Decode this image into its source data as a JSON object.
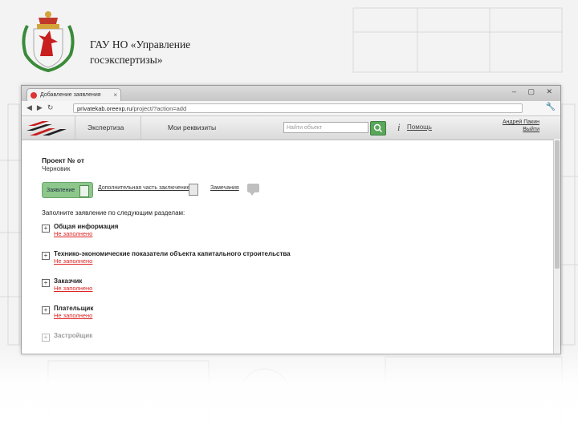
{
  "organization": {
    "title_line1": "ГАУ НО «Управление",
    "title_line2": "госэкспертизы»"
  },
  "browser": {
    "tab_title": "Добавление заявления",
    "url_prefix": "privatekab.oreexp.ru",
    "url_path": "/project/?action=add",
    "window_controls": "– ▢ ✕"
  },
  "app_header": {
    "nav_expertise": "Экспертиза",
    "nav_requisites": "Мои реквизиты",
    "search_placeholder": "Найти объект",
    "help_icon": "i",
    "help_label": "Помощь",
    "user_name": "Андрей Пакин",
    "logout_label": "Выйти"
  },
  "project": {
    "title": "Проект № от",
    "status": "Черновик"
  },
  "tabs": {
    "application": "Заявление",
    "additional": "Дополнительная часть заключение",
    "remarks": "Замечания"
  },
  "instructions": "Заполните заявление по следующим разделам:",
  "sections": [
    {
      "title": "Общая информация",
      "status": "Не заполнено"
    },
    {
      "title": "Технико-экономические показатели объекта капитального строительства",
      "status": "Не заполнено"
    },
    {
      "title": "Заказчик",
      "status": "Не заполнено"
    },
    {
      "title": "Плательщик",
      "status": "Не заполнено"
    },
    {
      "title": "Застройщик",
      "status": ""
    }
  ],
  "colors": {
    "accent_green": "#8dc78c",
    "status_red": "#d22222",
    "brand_red": "#c81e1e"
  },
  "icons": {
    "crest": "nizhny-novgorod-coat-of-arms",
    "logo": "red-black-stripes-logo",
    "search": "search-icon",
    "help": "info-icon",
    "remarks": "speech-bubble-icon"
  }
}
